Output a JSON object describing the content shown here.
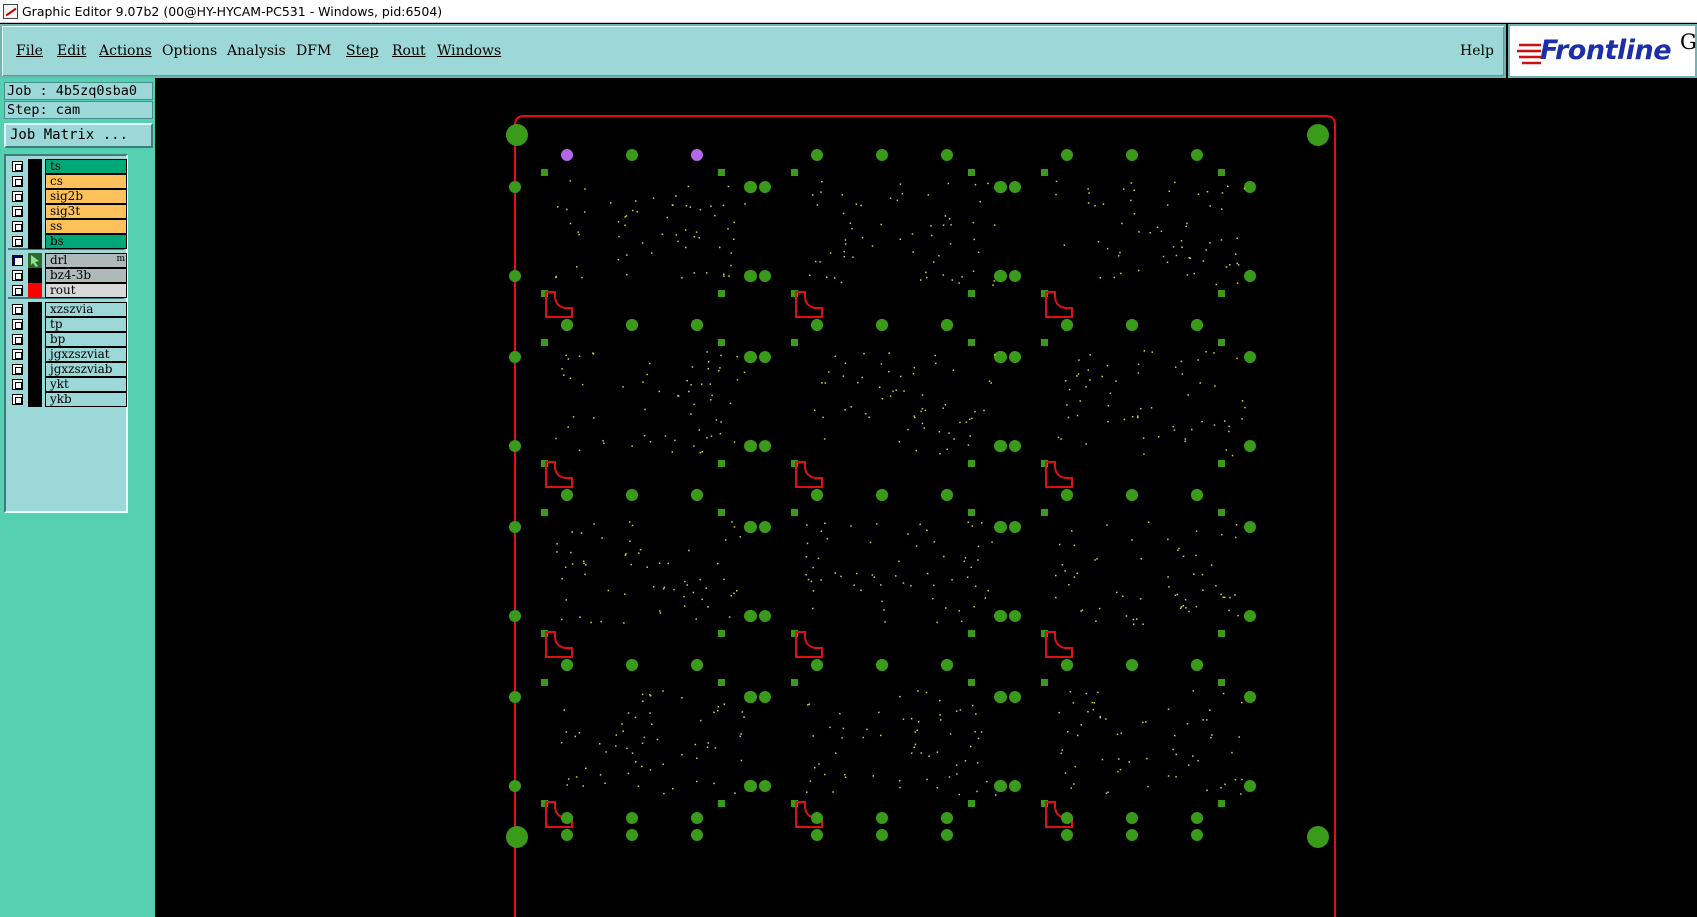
{
  "window": {
    "title": "Graphic Editor 9.07b2 (00@HY-HYCAM-PC531 - Windows, pid:6504)"
  },
  "menu": {
    "items": [
      "File",
      "Edit",
      "Actions",
      "Options",
      "Analysis",
      "DFM",
      "Step",
      "Rout",
      "Windows"
    ],
    "help": "Help"
  },
  "logo": {
    "text": "Frontline",
    "suffix": "G"
  },
  "job": {
    "job_line": "Job : 4b5zq0sba0",
    "step_line": "Step: cam",
    "matrix_button": "Job Matrix ..."
  },
  "layers": {
    "group1": [
      {
        "name": "ts",
        "color": "#00a878"
      },
      {
        "name": "cs",
        "color": "#ffc15a"
      },
      {
        "name": "sig2b",
        "color": "#ffc15a"
      },
      {
        "name": "sig3t",
        "color": "#ffc15a"
      },
      {
        "name": "ss",
        "color": "#ffc15a"
      },
      {
        "name": "bs",
        "color": "#00a878"
      }
    ],
    "group2": [
      {
        "name": "drl",
        "color": "#aeb9b9",
        "active": true,
        "tag": "m"
      },
      {
        "name": "bz4-3b",
        "color": "#aeb9b9"
      },
      {
        "name": "rout",
        "color": "#d8d8d8",
        "swatch": "#ff0000"
      }
    ],
    "group3": [
      {
        "name": "xzszvia",
        "color": "#9dd8d8"
      },
      {
        "name": "tp",
        "color": "#9dd8d8"
      },
      {
        "name": "bp",
        "color": "#9dd8d8"
      },
      {
        "name": "jgxzszviat",
        "color": "#9dd8d8"
      },
      {
        "name": "jgxzszviab",
        "color": "#9dd8d8"
      },
      {
        "name": "ykt",
        "color": "#9dd8d8"
      },
      {
        "name": "ykb",
        "color": "#9dd8d8"
      }
    ]
  },
  "colors": {
    "pad": "#3a9a1a",
    "highlight_pad": "#b068e8",
    "outline": "#e01010",
    "via": "#d8d040",
    "background": "#000000"
  }
}
